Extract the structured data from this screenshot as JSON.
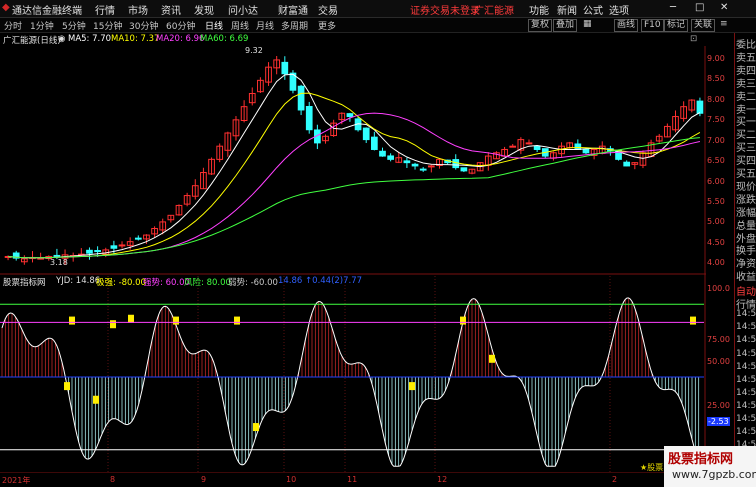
{
  "titlebar": {
    "app_title": "通达信金融终端",
    "menu": [
      "行情",
      "市场",
      "资讯",
      "发现",
      "问小达",
      "财富通",
      "交易"
    ],
    "login_notice": "证券交易未登录",
    "broker": "广汇能源",
    "right": [
      "功能",
      "新闻",
      "公式",
      "选项"
    ],
    "window_btn": "☒"
  },
  "periodbar": {
    "periods": [
      "分时",
      "1分钟",
      "5分钟",
      "15分钟",
      "30分钟",
      "60分钟",
      "日线",
      "周线",
      "月线",
      "多周期",
      "更多"
    ],
    "selected": "日线",
    "tools": [
      "复权",
      "叠加",
      "画线",
      "F10",
      "标记",
      "关联"
    ],
    "extra": "≡"
  },
  "main_info": {
    "stock": "广汇能源(日线)",
    "ma5": "MA5: 7.70",
    "ma10": "MA10: 7.37",
    "ma20": "MA20: 6.96",
    "ma60": "MA60: 6.69"
  },
  "indicator_info": {
    "name": "股票指标网",
    "yjd": "YJD: 14.86",
    "extreme_strong": "极强: -80.00",
    "strong": "强势: 60.00",
    "risk": "风险: 80.00",
    "weak": "弱势: -60.00",
    "ref": "14.86 ↑0.44(2)7.77"
  },
  "right_panel": [
    "委比",
    "卖五",
    "卖四",
    "卖三",
    "卖二",
    "卖一",
    "买一",
    "买二",
    "买三",
    "买四",
    "买五",
    "现价",
    "涨跌",
    "涨幅",
    "总量",
    "外盘",
    "换手",
    "净资",
    "收益",
    "自动",
    "行情",
    "14:58",
    "14:58",
    "14:58",
    "14:58",
    "14:58",
    "14:58",
    "14:58",
    "14:58",
    "14:58",
    "14:58",
    "14:58"
  ],
  "price_axis": [
    "9.32",
    "9.00",
    "8.50",
    "8.00",
    "7.50",
    "7.00",
    "6.50",
    "6.00",
    "5.50",
    "5.00",
    "4.50",
    "4.00"
  ],
  "price_ticks": [
    "9.00",
    "8.50",
    "8.00",
    "7.50",
    "7.00",
    "6.50",
    "6.00",
    "5.50",
    "5.00",
    "4.50",
    "4.00"
  ],
  "ind_axis": [
    "100.0",
    "75.00",
    "50.00",
    "25.00",
    "-2.53"
  ],
  "x_axis": [
    "2021年",
    "8",
    "9",
    "10",
    "11",
    "12",
    "2"
  ],
  "annotations": {
    "high": "9.32",
    "low": "3.18"
  },
  "watermark": {
    "line1": "股票指标网",
    "line2": "www.7gpzb.com",
    "corner": "★股票"
  },
  "chart_data": {
    "type": "candlestick",
    "title": "广汇能源(日线)",
    "ylim": [
      3.0,
      9.5
    ],
    "ind_ylim": [
      -100,
      100
    ],
    "closes": [
      3.35,
      3.3,
      3.28,
      3.32,
      3.3,
      3.35,
      3.38,
      3.4,
      3.38,
      3.42,
      3.45,
      3.5,
      3.55,
      3.6,
      3.7,
      3.8,
      3.9,
      4.0,
      4.2,
      4.4,
      4.6,
      4.9,
      5.2,
      5.5,
      5.9,
      6.3,
      6.7,
      7.1,
      7.5,
      7.9,
      8.3,
      8.7,
      9.1,
      9.32,
      8.9,
      8.4,
      7.8,
      7.2,
      6.8,
      7.0,
      7.4,
      7.7,
      7.6,
      7.2,
      6.9,
      6.6,
      6.4,
      6.3,
      6.35,
      6.2,
      6.1,
      6.0,
      6.1,
      6.3,
      6.2,
      6.05,
      5.95,
      6.0,
      6.2,
      6.4,
      6.5,
      6.6,
      6.7,
      6.9,
      6.8,
      6.6,
      6.4,
      6.5,
      6.7,
      6.8,
      6.6,
      6.5,
      6.6,
      6.7,
      6.55,
      6.3,
      6.1,
      6.2,
      6.5,
      6.8,
      7.0,
      7.3,
      7.6,
      7.9,
      8.1,
      7.7
    ]
  }
}
